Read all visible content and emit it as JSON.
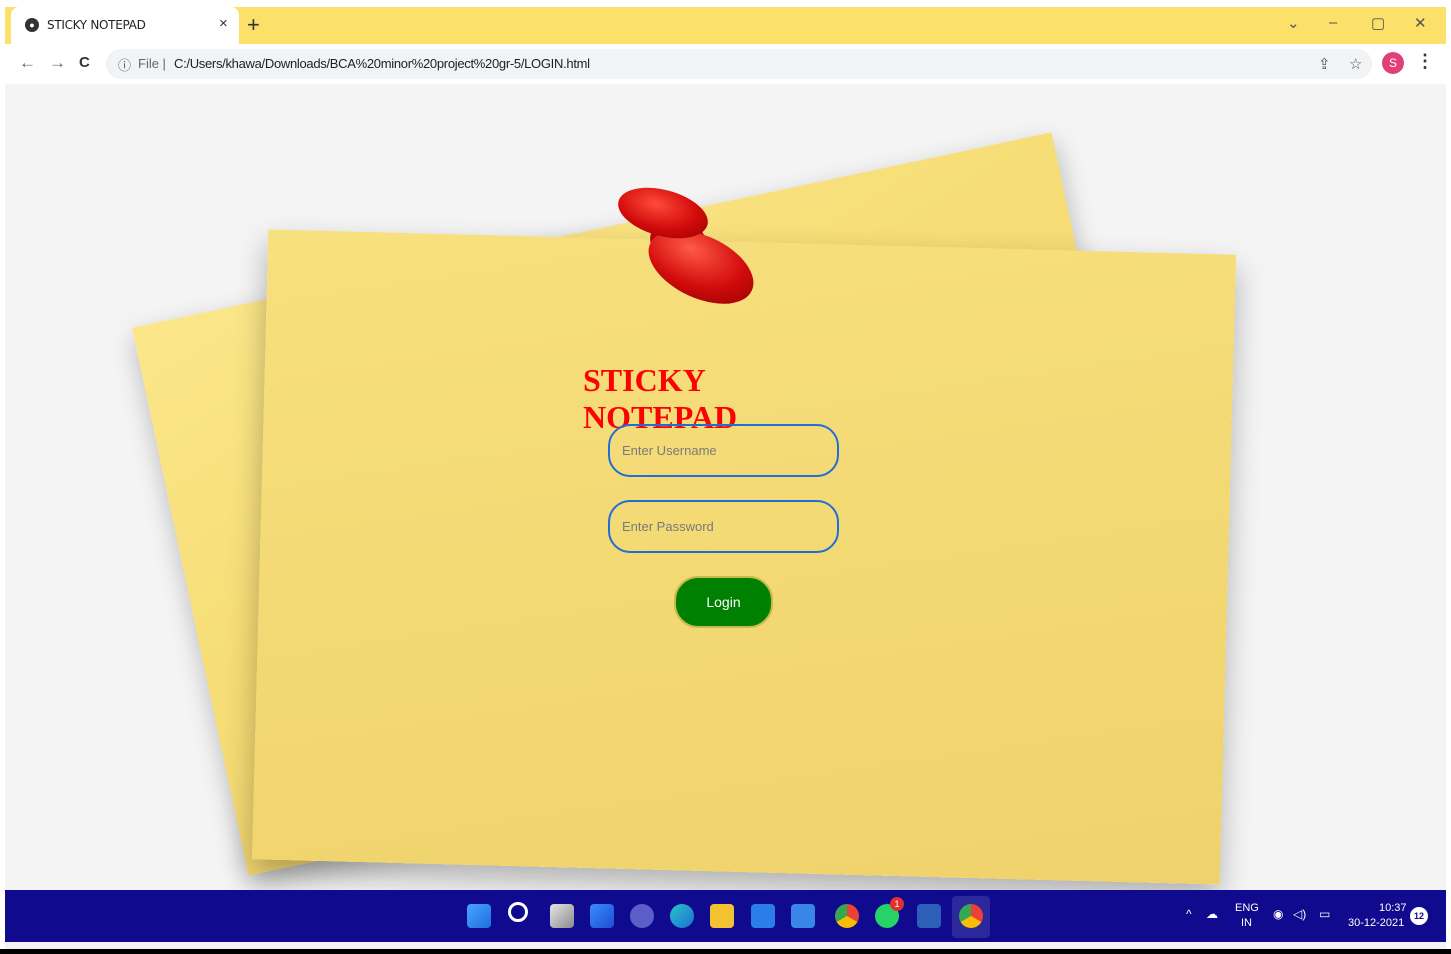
{
  "browser": {
    "tab_title": "STICKY NOTEPAD",
    "close_glyph": "×",
    "new_tab_glyph": "+",
    "nav": {
      "back": "←",
      "forward": "→",
      "reload": "C"
    },
    "omnibox": {
      "info_glyph": "ⓘ",
      "scheme_label": "File |",
      "url": "C:/Users/khawa/Downloads/BCA%20minor%20project%20gr-5/LOGIN.html"
    },
    "window_controls": {
      "dropdown": "⌄",
      "minimize": "–",
      "maximize": "▢",
      "close": "✕"
    },
    "toolbar_icons": {
      "share": "⇪",
      "bookmark": "☆"
    },
    "profile_initial": "S",
    "menu_glyph": "⋮"
  },
  "page": {
    "title": "STICKY NOTEPAD",
    "username_placeholder": "Enter Username",
    "password_placeholder": "Enter Password",
    "login_label": "Login"
  },
  "taskbar": {
    "whatsapp_badge": "1",
    "tray": {
      "lang_line1": "ENG",
      "lang_line2": "IN",
      "time": "10:37",
      "date": "30-12-2021",
      "notifications": "12",
      "chevron": "^",
      "wifi": "◉",
      "volume": "◁)",
      "battery": "▭"
    }
  },
  "colors": {
    "tabstrip": "#fbe06a",
    "title_red": "#ff0000",
    "login_green": "#008000",
    "field_border": "#1f6fd6",
    "taskbar": "#0f0a8e"
  }
}
